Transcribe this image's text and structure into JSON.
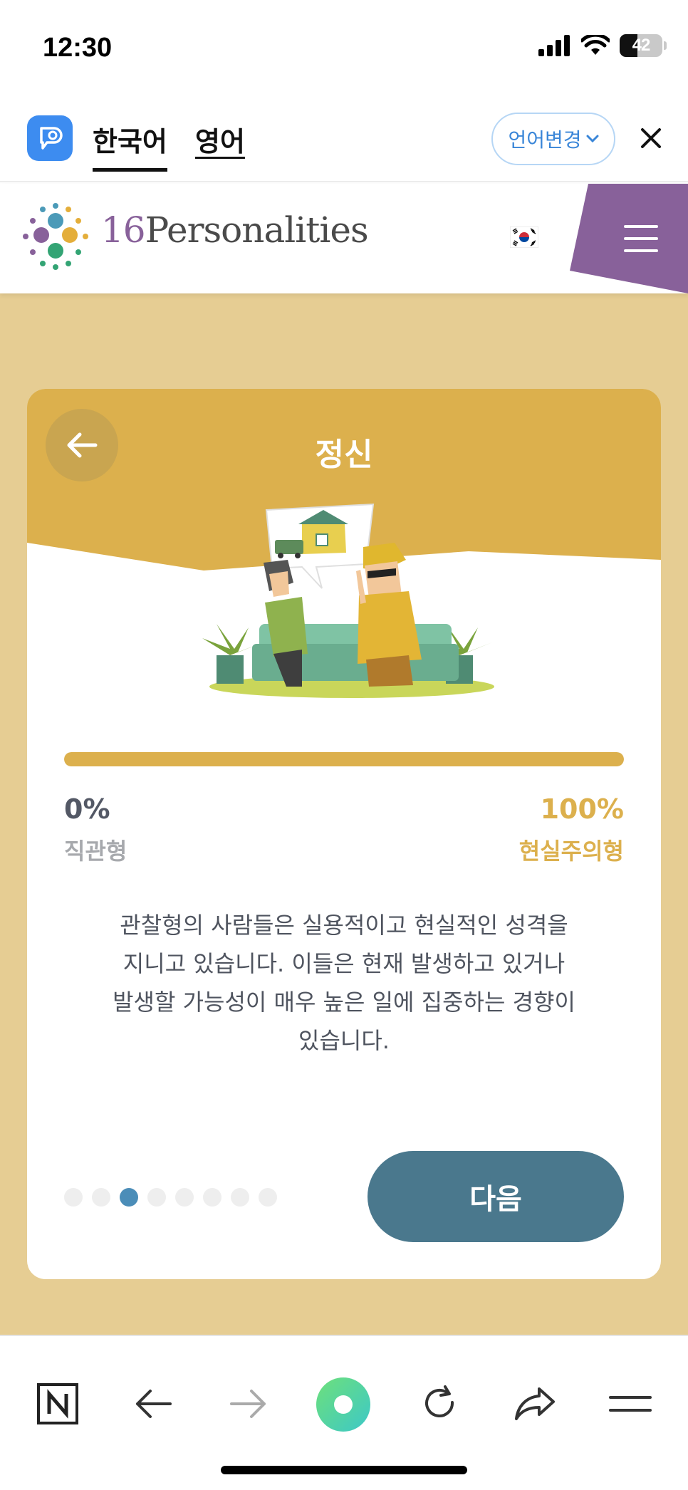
{
  "status_bar": {
    "time": "12:30",
    "battery": "42",
    "battery_level": 0.42
  },
  "translate_bar": {
    "tabs": [
      {
        "label": "한국어",
        "active": true
      },
      {
        "label": "영어",
        "active": false
      }
    ],
    "language_change_label": "언어변경",
    "accent_color": "#3a86d8"
  },
  "site_header": {
    "logo_number": "16",
    "logo_word": "Personalities",
    "menu_color": "#88619a"
  },
  "card": {
    "title": "정신",
    "progress": 1.0,
    "left_percent": "0%",
    "left_label": "직관형",
    "right_percent": "100%",
    "right_label": "현실주의형",
    "description_lines": [
      "관찰형의 사람들은 실용적이고 현실적인 성격을",
      "지니고 있습니다. 이들은 현재 발생하고 있거나",
      "발생할 가능성이 매우 높은 일에 집중하는 경향이",
      "있습니다."
    ],
    "pagination": {
      "total": 8,
      "active_index": 2
    },
    "next_label": "다음",
    "accent_color": "#dcb04d",
    "button_color": "#4a788d"
  },
  "bottom_toolbar": {
    "icons": [
      "naver-icon",
      "back-arrow-icon",
      "forward-arrow-icon",
      "green-dot-icon",
      "refresh-icon",
      "share-icon",
      "menu-icon"
    ]
  }
}
